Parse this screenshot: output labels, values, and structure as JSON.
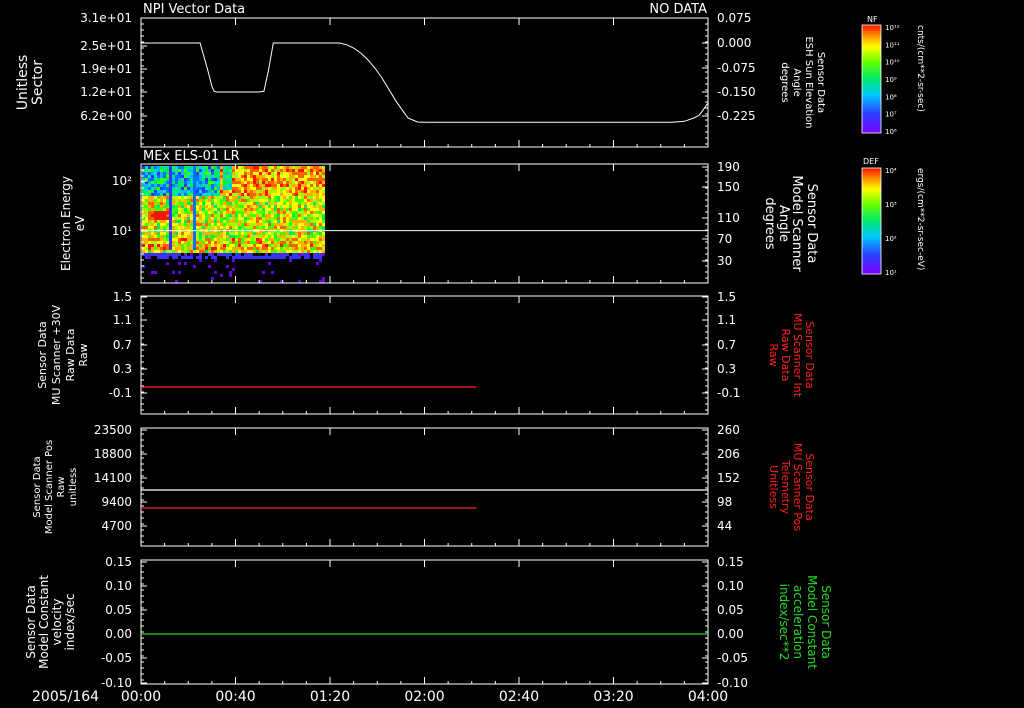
{
  "header": {
    "title": "NPI Vector Data",
    "status": "NO DATA"
  },
  "colors": {
    "background": "#000000",
    "axis": "#ffffff",
    "red": "#ff2020",
    "green": "#22dd22"
  },
  "footer": {
    "date_label": "2005/164"
  },
  "chart_data": [
    {
      "type": "line",
      "panel": "Sector / ESH Sun Elevation",
      "ylabel": [
        "Sector",
        "Unitless"
      ],
      "yticks": [
        "3.1e+01",
        "2.5e+01",
        "1.9e+01",
        "1.2e+01",
        "6.2e+00"
      ],
      "ylabel_right": [
        "Sensor Data",
        "ESH Sun Elevation",
        "Angle",
        "degrees"
      ],
      "yticks_right": [
        "0.075",
        "0.000",
        "-0.075",
        "-0.150",
        "-0.225"
      ],
      "ylim_right": [
        -0.3,
        0.075
      ],
      "series": [
        {
          "color": "#ffffff",
          "axis": "right",
          "x": [
            0,
            25,
            26,
            28,
            30,
            31,
            32,
            34,
            50,
            52,
            54,
            56,
            84,
            87,
            90,
            93,
            96,
            99,
            102,
            105,
            108,
            111,
            113,
            117,
            120,
            225,
            226,
            230,
            232,
            234,
            236,
            237,
            238,
            239,
            240
          ],
          "y": [
            0.0,
            0.0,
            -0.025,
            -0.075,
            -0.13,
            -0.145,
            -0.147,
            -0.147,
            -0.147,
            -0.145,
            -0.08,
            0.0,
            0.0,
            -0.005,
            -0.015,
            -0.03,
            -0.05,
            -0.075,
            -0.105,
            -0.14,
            -0.175,
            -0.205,
            -0.225,
            -0.237,
            -0.238,
            -0.238,
            -0.237,
            -0.235,
            -0.23,
            -0.225,
            -0.218,
            -0.21,
            -0.2,
            -0.19,
            -0.18
          ]
        }
      ]
    },
    {
      "type": "heatmap",
      "panel": "MEx ELS-01 LR",
      "title": "MEx ELS-01 LR",
      "ylabel": [
        "Electron Energy",
        "eV"
      ],
      "yticks": [
        "10²",
        "10¹"
      ],
      "ylabel_right": [
        "Sensor Data",
        "Model Scanner",
        "Angle",
        "degrees"
      ],
      "yticks_right": [
        "190",
        "150",
        "110",
        "70",
        "30"
      ],
      "ylim_right": [
        0,
        190
      ],
      "colorbar_label": "DEF",
      "colorbar_unit": "ergs/(cm**2-sr-sec-eV)",
      "colorbar_ticks": [
        "10⁴",
        "10³",
        "10²",
        "10¹"
      ],
      "spectrogram_end_x": 77,
      "series": [
        {
          "color": "#ffffff",
          "axis": "right",
          "x": [
            0,
            240
          ],
          "y": [
            90,
            90
          ]
        }
      ]
    },
    {
      "type": "line",
      "panel": "MU Scanner +30V / Scanner Int",
      "ylabel": [
        "Sensor Data",
        "MU Scanner +30V",
        "Raw Data",
        "Raw"
      ],
      "yticks": [
        "1.5",
        "1.1",
        "0.7",
        "0.3",
        "-0.1"
      ],
      "ylim": [
        -0.3,
        1.5
      ],
      "ylabel_right": [
        "Sensor Data",
        "MU Scanner Int",
        "Raw Data",
        "Raw"
      ],
      "yticks_right": [
        "1.5",
        "1.1",
        "0.7",
        "0.3",
        "-0.1"
      ],
      "ylim_right": [
        -0.3,
        1.5
      ],
      "series": [
        {
          "color": "#ff2020",
          "axis": "right",
          "x": [
            0,
            142
          ],
          "y": [
            0.0,
            0.0
          ]
        }
      ]
    },
    {
      "type": "line",
      "panel": "Scanner Pos",
      "ylabel": [
        "Sensor Data",
        "Model Scanner Pos",
        "Raw",
        "unitless"
      ],
      "yticks": [
        "23500",
        "18800",
        "14100",
        "9400",
        "4700"
      ],
      "ylim": [
        0,
        23500
      ],
      "ylabel_right": [
        "Sensor Data",
        "MU Scanner Pos",
        "Telemetry",
        "Unitless"
      ],
      "yticks_right": [
        "260",
        "206",
        "152",
        "98",
        "44"
      ],
      "ylim_right": [
        0,
        260
      ],
      "series": [
        {
          "color": "#ffffff",
          "axis": "left",
          "x": [
            0,
            240
          ],
          "y": [
            11900,
            11900
          ]
        },
        {
          "color": "#ff2020",
          "axis": "right",
          "x": [
            0,
            142
          ],
          "y": [
            88,
            88
          ]
        }
      ]
    },
    {
      "type": "line",
      "panel": "Model Constant",
      "ylabel": [
        "Sensor Data",
        "Model Constant",
        "velocity",
        "index/sec"
      ],
      "yticks": [
        "0.15",
        "0.10",
        "0.05",
        "0.00",
        "-0.05",
        "-0.10"
      ],
      "ylim": [
        -0.1,
        0.15
      ],
      "ylabel_right": [
        "Sensor Data",
        "Model Constant",
        "acceleration",
        "index/sec**2"
      ],
      "yticks_right": [
        "0.15",
        "0.10",
        "0.05",
        "0.00",
        "-0.05",
        "-0.10"
      ],
      "ylim_right": [
        -0.1,
        0.15
      ],
      "series": [
        {
          "color": "#22dd22",
          "axis": "left",
          "x": [
            0,
            240
          ],
          "y": [
            0.0,
            0.0
          ]
        }
      ],
      "xticks": [
        "00:00",
        "00:40",
        "01:20",
        "02:00",
        "02:40",
        "03:20",
        "04:00"
      ],
      "xlim": [
        0,
        240
      ]
    }
  ],
  "colorbars": [
    {
      "label": "NF",
      "unit": "cnts/(cm**2-sr-sec)",
      "ticks": [
        "10¹²",
        "10¹¹",
        "10¹⁰",
        "10⁹",
        "10⁸",
        "10⁷",
        "10⁶"
      ]
    }
  ]
}
